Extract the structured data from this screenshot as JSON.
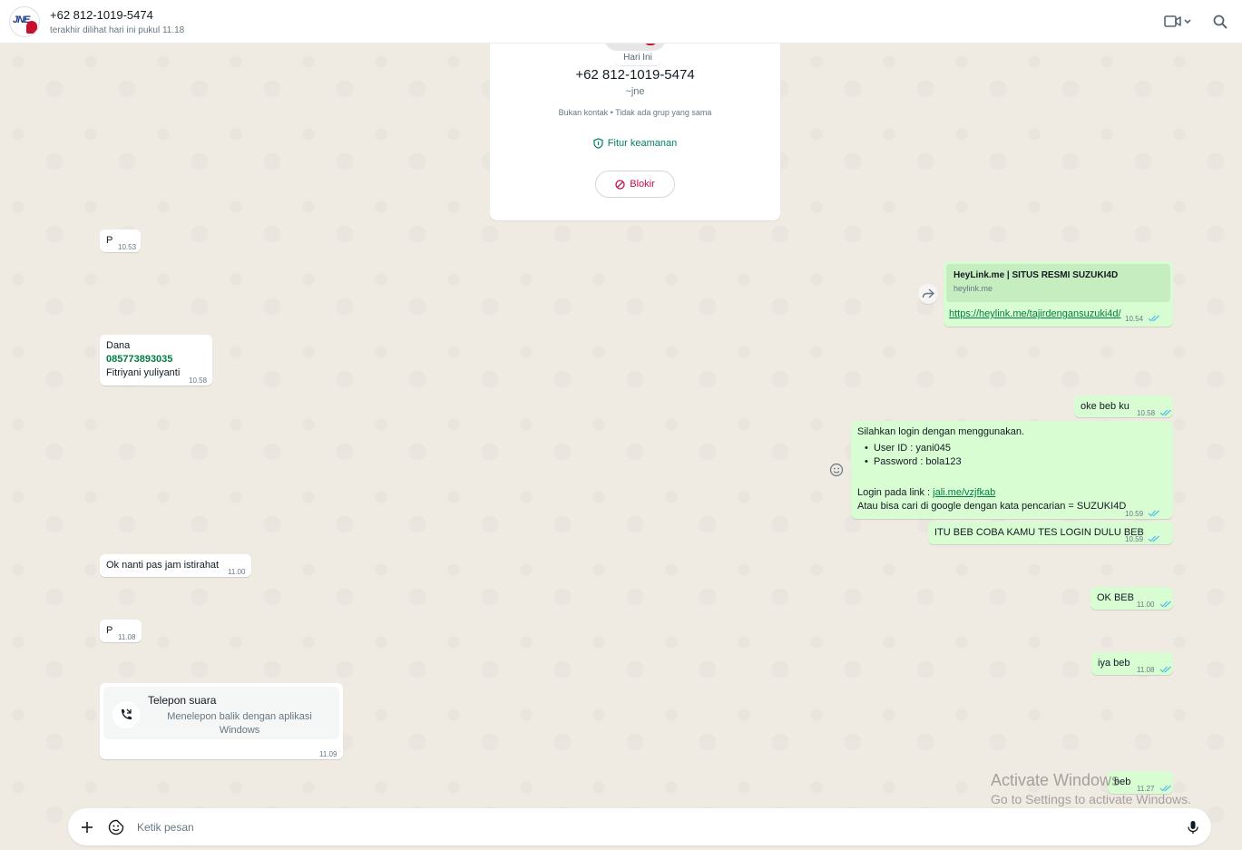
{
  "header": {
    "contact_name": "+62 812-1019-5474",
    "last_seen": "terakhir dilihat hari ini pukul 11.18",
    "avatar_text": "JNE"
  },
  "info_card": {
    "date_label": "Hari Ini",
    "phone": "+62 812-1019-5474",
    "alias": "~jne",
    "note": "Bukan kontak • Tidak ada grup yang sama",
    "security_label": "Fitur keamanan",
    "block_label": "Blokir"
  },
  "messages": {
    "m1": {
      "text": "P",
      "time": "10.53"
    },
    "m2": {
      "preview_title": "HeyLink.me | SITUS RESMI SUZUKI4D",
      "preview_domain": "heylink.me",
      "link": "https://heylink.me/tajirdengansuzuki4d/",
      "time": "10.54"
    },
    "m3": {
      "line1": "Dana",
      "number": "085773893035",
      "line3": "Fitriyani yuliyanti",
      "time": "10.58"
    },
    "m4": {
      "text": "oke beb ku",
      "time": "10.58"
    },
    "m5": {
      "line1": "Silahkan login dengan menggunakan.",
      "bullet1": "User ID : yani045",
      "bullet2": "Password : bola123",
      "login_prefix": "Login pada link : ",
      "login_link": "jali.me/vzjfkab",
      "line_last": "Atau bisa cari di google dengan kata pencarian = SUZUKI4D",
      "time": "10.59"
    },
    "m6": {
      "text": "ITU BEB COBA KAMU TES LOGIN DULU BEB",
      "time": "10.59"
    },
    "m7": {
      "text": "Ok nanti pas jam istirahat",
      "time": "11.00"
    },
    "m8": {
      "text": "OK BEB",
      "time": "11.00"
    },
    "m9": {
      "text": "P",
      "time": "11.08"
    },
    "m10": {
      "text": "iya beb",
      "time": "11.08"
    },
    "m11": {
      "title": "Telepon suara",
      "subtitle_1": "Menelepon balik dengan aplikasi",
      "subtitle_2": "Windows",
      "time": "11.09"
    },
    "m12": {
      "text": "beb",
      "time": "11.27"
    }
  },
  "composer": {
    "placeholder": "Ketik pesan"
  },
  "watermark": {
    "line1": "Activate Windows",
    "line2": "Go to Settings to activate Windows."
  },
  "colors": {
    "outgoing": "#d9fdd3",
    "incoming": "#ffffff",
    "accent": "#008069",
    "danger": "#c01048",
    "ticks": "#53bdeb"
  }
}
